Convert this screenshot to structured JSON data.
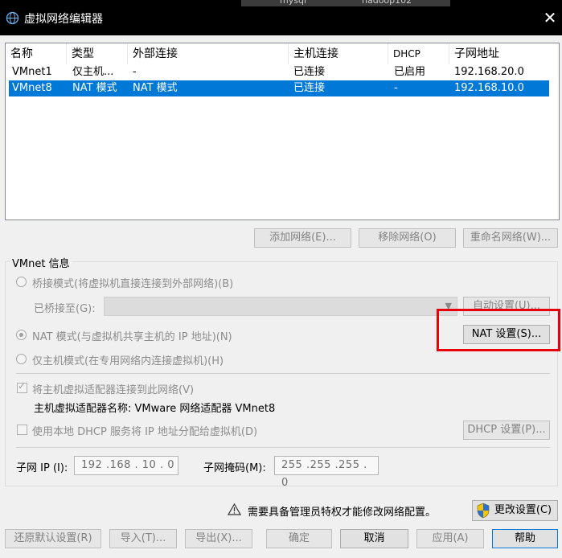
{
  "window": {
    "title": "虚拟网络编辑器",
    "background_tabs": [
      "mysql",
      "hadoop102"
    ]
  },
  "list": {
    "columns": [
      "名称",
      "类型",
      "外部连接",
      "主机连接",
      "DHCP",
      "子网地址"
    ],
    "rows": [
      {
        "name": "VMnet1",
        "type": "仅主机...",
        "external": "-",
        "host": "已连接",
        "dhcp": "已启用",
        "subnet": "192.168.20.0",
        "selected": false
      },
      {
        "name": "VMnet8",
        "type": "NAT 模式",
        "external": "NAT 模式",
        "host": "已连接",
        "dhcp": "-",
        "subnet": "192.168.10.0",
        "selected": true
      }
    ]
  },
  "list_buttons": {
    "add": "添加网络(E)...",
    "remove": "移除网络(O)",
    "rename": "重命名网络(W)..."
  },
  "vmnet_info": {
    "group_label": "VMnet 信息",
    "bridged_label": "桥接模式(将虚拟机直接连接到外部网络)(B)",
    "bridged_to_label": "已桥接至(G):",
    "bridged_to_value": "",
    "auto_settings": "自动设置(U)...",
    "nat_label": "NAT 模式(与虚拟机共享主机的 IP 地址)(N)",
    "nat_settings": "NAT 设置(S)...",
    "host_only_label": "仅主机模式(在专用网络内连接虚拟机)(H)",
    "connect_adapter_label": "将主机虚拟适配器连接到此网络(V)",
    "adapter_name_label": "主机虚拟适配器名称: VMware 网络适配器 VMnet8",
    "dhcp_label": "使用本地 DHCP 服务将 IP 地址分配给虚拟机(D)",
    "dhcp_settings": "DHCP 设置(P)...",
    "subnet_ip_label": "子网 IP (I):",
    "subnet_ip_value": "192 .168 . 10 .  0",
    "subnet_mask_label": "子网掩码(M):",
    "subnet_mask_value": "255 .255 .255 .  0",
    "selected_mode": "nat",
    "connect_adapter_checked": true,
    "dhcp_checked": false
  },
  "notice": {
    "text": "需要具备管理员特权才能修改网络配置。",
    "change_settings": "更改设置(C)"
  },
  "footer_buttons": {
    "restore": "还原默认设置(R)",
    "import": "导入(T)...",
    "export": "导出(X)...",
    "ok": "确定",
    "cancel": "取消",
    "apply": "应用(A)",
    "help": "帮助"
  },
  "colors": {
    "selection": "#0078d7",
    "highlight_box": "#e8000b",
    "titlebar": "#000000"
  }
}
